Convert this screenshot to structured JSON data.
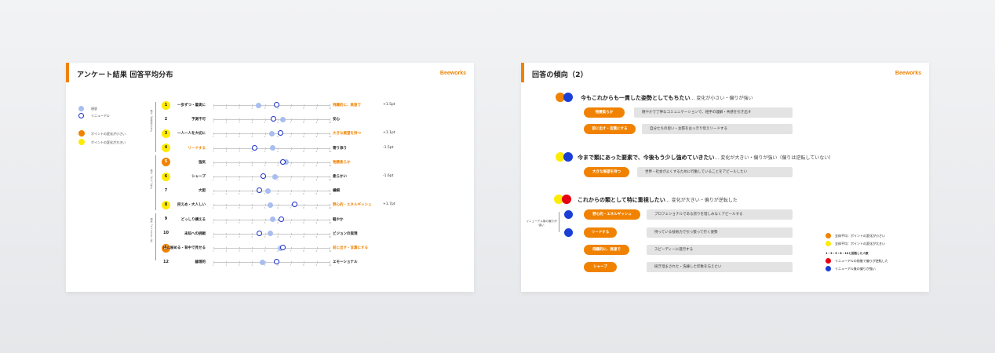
{
  "left_slide": {
    "title": "アンケート結果 回答平均分布",
    "logo": "Beeworks",
    "legend": {
      "current": "現状",
      "renewal": "リニューアル",
      "small_change": "ポイントの変化が小さい",
      "large_change": "ポイントの変化が大きい"
    },
    "groups": [
      "飛び「未来感のなさ」",
      "飛び「大人っぽさ」",
      "現状「キャラクター化」"
    ],
    "axis_ticks": [
      "1",
      "2",
      "3",
      "4",
      "5",
      "6",
      "7",
      "8",
      "9",
      "10"
    ],
    "rows": [
      {
        "num": "1",
        "left": "一歩ずつ・着実に",
        "right": "飛躍的に、高速で",
        "right_hl": true,
        "mark": "yellow",
        "current": 4.5,
        "renewal": 5.9,
        "diff": "+1.5pt"
      },
      {
        "num": "2",
        "left": "予測不可",
        "right": "安心",
        "right_hl": false,
        "mark": "none",
        "current": 6.4,
        "renewal": 5.7,
        "diff": ""
      },
      {
        "num": "3",
        "left": "一人一人を大切に",
        "right": "大きな展望を持つ",
        "right_hl": true,
        "mark": "yellow",
        "current": 5.5,
        "renewal": 6.2,
        "diff": "+1.1pt"
      },
      {
        "num": "4",
        "left": "リードする",
        "left_hl": true,
        "right": "寄り添う",
        "right_hl": false,
        "mark": "yellow",
        "current": 5.6,
        "renewal": 4.2,
        "diff": "-1.5pt"
      },
      {
        "num": "5",
        "left": "強気",
        "right": "物腰柔らか",
        "right_hl": true,
        "mark": "orange",
        "current": 6.6,
        "renewal": 6.4,
        "diff": ""
      },
      {
        "num": "6",
        "left": "シャープ",
        "right": "柔らかい",
        "right_hl": false,
        "mark": "yellow",
        "current": 5.8,
        "renewal": 4.9,
        "diff": "-1.6pt"
      },
      {
        "num": "7",
        "left": "大胆",
        "right": "繊細",
        "right_hl": false,
        "mark": "none",
        "current": 5.2,
        "renewal": 4.6,
        "diff": ""
      },
      {
        "num": "8",
        "left": "控えめ・大人しい",
        "right": "野心的・エネルギッシュ",
        "right_hl": true,
        "mark": "yellow",
        "current": 5.4,
        "renewal": 7.3,
        "diff": "+1.7pt"
      },
      {
        "num": "9",
        "left": "どっしり構える",
        "right": "軽やか",
        "right_hl": false,
        "mark": "none",
        "current": 5.6,
        "renewal": 6.3,
        "diff": ""
      },
      {
        "num": "10",
        "left": "未知への挑戦",
        "right": "ビジョンの実現",
        "right_hl": false,
        "mark": "none",
        "current": 5.4,
        "renewal": 4.6,
        "diff": ""
      },
      {
        "num": "11",
        "left": "内に秘める・背中で見せる",
        "right": "前に出す・言葉にする",
        "right_hl": true,
        "mark": "orange",
        "current": 6.2,
        "renewal": 6.4,
        "diff": ""
      },
      {
        "num": "12",
        "left": "論理的",
        "right": "エモーショナル",
        "right_hl": false,
        "mark": "none",
        "current": 4.8,
        "renewal": 5.9,
        "diff": ""
      }
    ]
  },
  "right_slide": {
    "title": "回答の傾向（2）",
    "logo": "Beeworks",
    "sections": [
      {
        "heading": "今もこれからも一貫した姿勢としてもちたい",
        "sub": "… 変化が小さい・偏りが強い",
        "dots": [
          "#f08200",
          "#1a3fd6"
        ],
        "items": [
          {
            "pill": "物腰柔らか",
            "text": "穏やかで丁寧なコミュニケーションで、相手の理解・共感を引き出す"
          },
          {
            "pill": "前に出す・言葉にする",
            "text": "自分たちの思い・主張をはっきり伝えリードする"
          }
        ]
      },
      {
        "heading": "今まで類にあった要素で、今後もう少し強めていきたい",
        "sub": "… 変化が大きい・偏りが強い（偏りは逆転していない）",
        "dots": [
          "#ffeb00",
          "#1a3fd6"
        ],
        "items": [
          {
            "pill": "大きな展望を持つ",
            "text": "世界・社会がよくするために行動していることをアピールしたい"
          }
        ]
      },
      {
        "heading": "これからの類として特に重視したい",
        "sub": "… 変化が大きい・偏りが逆転した",
        "dots": [
          "#ffeb00",
          "#e60012"
        ],
        "side_label": "リニューアル後の偏りが強い",
        "items": [
          {
            "pill": "野心的・エネルギッシュ",
            "text": "プロフェショナルである誇りを惜しみなくアピールする"
          },
          {
            "pill": "リードする",
            "text": "持っている技術力で引っ張って行く姿勢"
          },
          {
            "pill": "飛躍的に、高速で",
            "text": "スピーディーに進行する"
          },
          {
            "pill": "シャープ",
            "text": "研ぎ澄まされた・洗練した印象を与えたい"
          }
        ]
      }
    ],
    "legend": {
      "orange": "全体平均：ポイントの変化が小さい",
      "yellow": "全体平均：ポイントの変化が大きい",
      "heading": "1・3・5・8・10と回答した人数",
      "red": "リニューアルの前後で偏りが逆転した",
      "blue": "リニューアル後の偏りが強い"
    }
  },
  "colors": {
    "accent": "#f08200",
    "yellow": "#ffeb00",
    "blue": "#1a2fc8",
    "light_blue": "#a8bdf0",
    "red": "#e60012"
  }
}
